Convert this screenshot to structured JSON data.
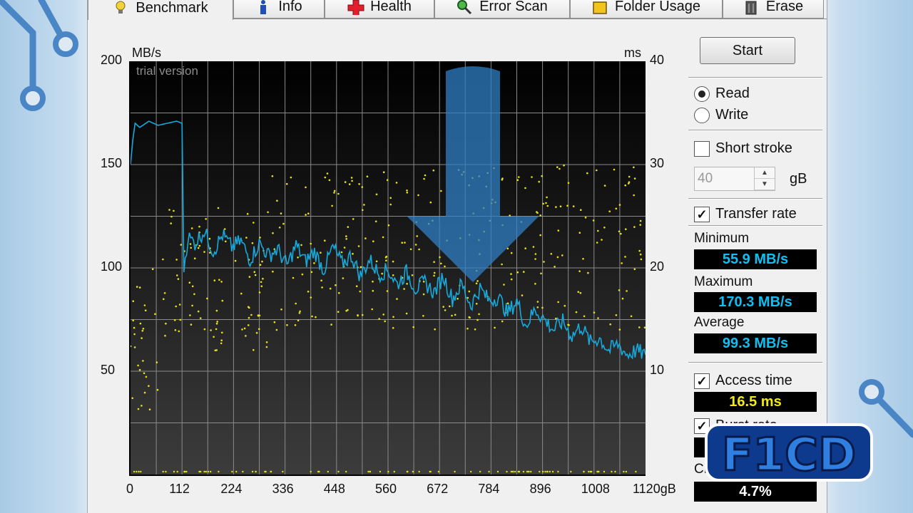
{
  "tabs": [
    {
      "label": "Benchmark",
      "icon": "bulb-icon",
      "active": true
    },
    {
      "label": "Info",
      "icon": "info-icon",
      "active": false
    },
    {
      "label": "Health",
      "icon": "health-cross-icon",
      "active": false
    },
    {
      "label": "Error Scan",
      "icon": "magnifier-icon",
      "active": false
    },
    {
      "label": "Folder Usage",
      "icon": "folder-icon",
      "active": false
    },
    {
      "label": "Erase",
      "icon": "trash-icon",
      "active": false
    }
  ],
  "graph": {
    "left_unit": "MB/s",
    "right_unit": "ms",
    "watermark": "trial version",
    "left_ticks": [
      "200",
      "150",
      "100",
      "50"
    ],
    "right_ticks": [
      "40",
      "30",
      "20",
      "10"
    ],
    "x_ticks": [
      "0",
      "112",
      "224",
      "336",
      "448",
      "560",
      "672",
      "784",
      "896",
      "1008",
      "1120gB"
    ]
  },
  "chart_data": {
    "type": "line",
    "x_unit": "gB",
    "xlim": [
      0,
      1120
    ],
    "ylim_left": [
      0,
      200
    ],
    "ylim_right": [
      0,
      40
    ],
    "grid": true,
    "series": [
      {
        "name": "Transfer rate",
        "axis": "left",
        "color": "#15a9dc",
        "x": [
          0,
          5,
          10,
          20,
          40,
          60,
          80,
          100,
          112,
          116,
          125,
          140,
          160,
          180,
          200,
          220,
          240,
          260,
          280,
          300,
          320,
          340,
          360,
          380,
          400,
          420,
          440,
          460,
          480,
          500,
          520,
          540,
          560,
          580,
          600,
          620,
          640,
          660,
          680,
          700,
          720,
          740,
          760,
          780,
          800,
          820,
          840,
          860,
          880,
          900,
          920,
          940,
          960,
          980,
          1000,
          1020,
          1040,
          1060,
          1080,
          1100,
          1120
        ],
        "y": [
          150,
          162,
          170,
          168,
          171,
          169,
          170,
          171,
          170,
          100,
          115,
          112,
          118,
          108,
          116,
          110,
          113,
          104,
          112,
          106,
          109,
          101,
          111,
          103,
          108,
          99,
          110,
          102,
          106,
          96,
          104,
          97,
          99,
          92,
          98,
          90,
          93,
          88,
          96,
          85,
          92,
          82,
          90,
          84,
          86,
          78,
          84,
          72,
          80,
          75,
          70,
          74,
          67,
          72,
          64,
          66,
          60,
          63,
          58,
          60,
          58
        ]
      },
      {
        "name": "Access time",
        "axis": "right",
        "color": "#e8e21a",
        "type": "scatter",
        "description": "scattered access-time points, mostly between 8 and 28 ms"
      }
    ]
  },
  "panel": {
    "start_label": "Start",
    "read_label": "Read",
    "write_label": "Write",
    "short_stroke_label": "Short stroke",
    "short_stroke_value": "40",
    "short_stroke_unit": "gB",
    "transfer_rate_label": "Transfer rate",
    "minimum_label": "Minimum",
    "minimum_value": "55.9 MB/s",
    "maximum_label": "Maximum",
    "maximum_value": "170.3 MB/s",
    "average_label": "Average",
    "average_value": "99.3 MB/s",
    "access_time_label": "Access time",
    "access_time_value": "16.5 ms",
    "burst_rate_label": "Burst rate",
    "cpu_label": "CPU usage",
    "cpu_value": "4.7%",
    "read_selected": true,
    "short_stroke_checked": false,
    "transfer_rate_checked": true,
    "access_time_checked": true,
    "burst_rate_checked": true
  },
  "watermark_logo": "F1CD",
  "colors": {
    "transfer_line": "#15a9dc",
    "access_points": "#e8e21a",
    "arrow_overlay": "#2f7fc4",
    "cyan_text": "#11bff2",
    "yellow_text": "#f2ea16"
  }
}
